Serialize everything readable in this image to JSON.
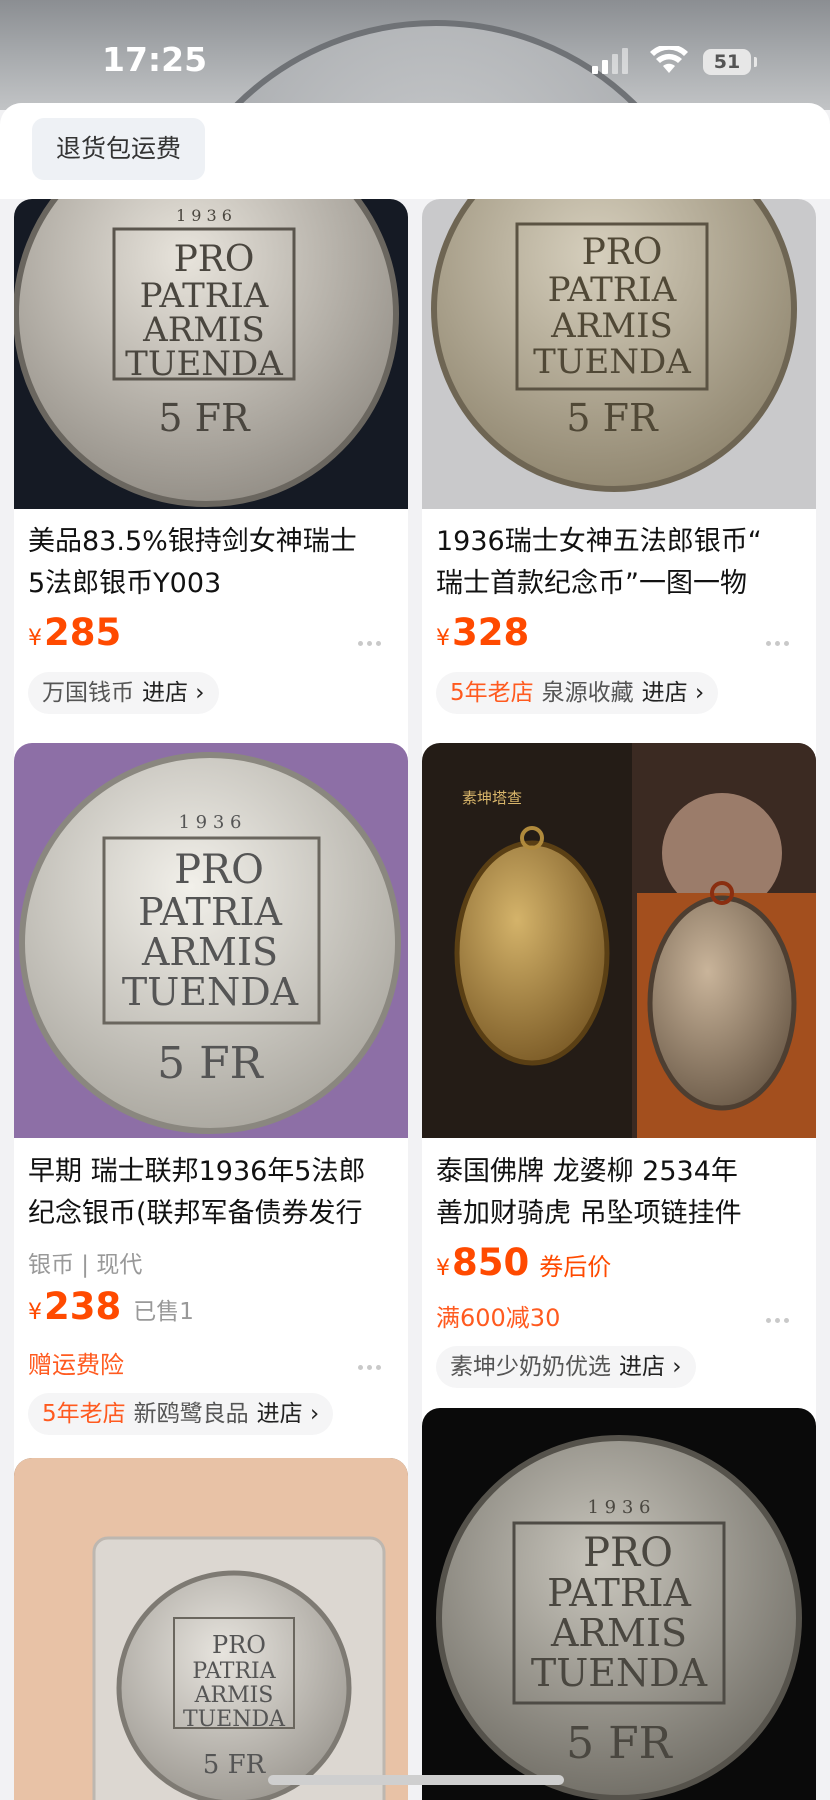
{
  "status_bar": {
    "time": "17:25",
    "battery": "51"
  },
  "filter": {
    "chip_label": "退货包运费"
  },
  "products": [
    {
      "title_line1": "美品83.5%银持剑女神瑞士",
      "title_line2": "5法郎银币Y003",
      "currency": "¥",
      "price": "285",
      "shop_name": "万国钱币",
      "go_shop": "进店 ›"
    },
    {
      "title_line1": "1936瑞士女神五法郎银币“",
      "title_line2": "瑞士首款纪念币”一图一物",
      "currency": "¥",
      "price": "328",
      "shop_tag": "5年老店",
      "shop_name": "泉源收藏",
      "go_shop": "进店 ›"
    },
    {
      "title_line1": "早期 瑞士联邦1936年5法郎",
      "title_line2": "纪念银币(联邦军备债券发行",
      "meta": "银币 | 现代",
      "currency": "¥",
      "price": "238",
      "sold": "已售1",
      "promo": "赠运费险",
      "shop_tag": "5年老店",
      "shop_name": "新鸥鹭良品",
      "go_shop": "进店 ›"
    },
    {
      "title_line1": "泰国佛牌 龙婆柳  2534年",
      "title_line2": "善加财骑虎 吊坠项链挂件",
      "currency": "¥",
      "price": "850",
      "price_suffix": "券后价",
      "promo": "满600减30",
      "shop_name": "素坤少奶奶优选",
      "go_shop": "进店 ›"
    }
  ],
  "coin_text": {
    "year": "1 9 3 6",
    "l1": "PRO",
    "l2": "PATRIA",
    "l3": "ARMIS",
    "l4": "TUENDA",
    "denom": "5 FR"
  },
  "amulet_brand": "素坤塔查"
}
